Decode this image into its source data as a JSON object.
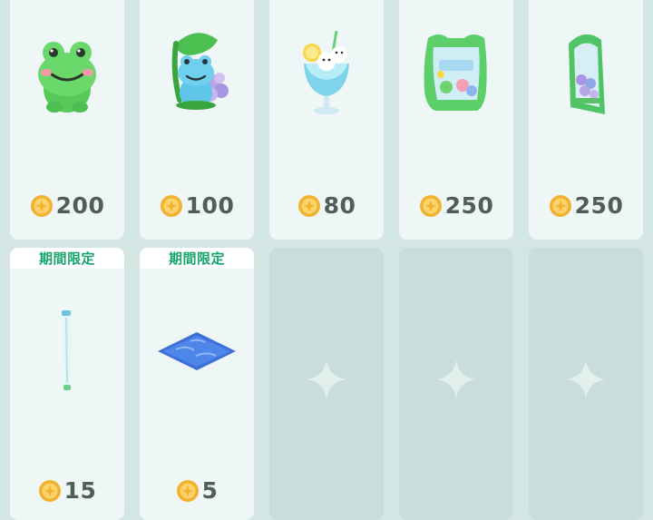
{
  "colors": {
    "page_background": "#d4e6e4",
    "card_background": "#eef7f6",
    "empty_slot": "#c9dedb",
    "price_text": "#4d5e5b",
    "limited_badge_text": "#16a46a",
    "coin": "#f2b230"
  },
  "currency_icon": "coin-icon",
  "shop": {
    "items": [
      {
        "art": "frog-plush-icon",
        "price": "200"
      },
      {
        "art": "frog-leaf-hydrangea-figure-icon",
        "price": "100"
      },
      {
        "art": "blue-cream-soda-icon",
        "price": "80"
      },
      {
        "art": "frog-stained-glass-sign-icon",
        "price": "250"
      },
      {
        "art": "hydrangea-arch-window-icon",
        "price": "250"
      },
      {
        "art": "glass-pole-icon",
        "price": "15",
        "badge": "期間限定"
      },
      {
        "art": "blue-water-tile-icon",
        "price": "5",
        "badge": "期間限定"
      }
    ],
    "empty_slot_icon": "sparkle-icon"
  }
}
